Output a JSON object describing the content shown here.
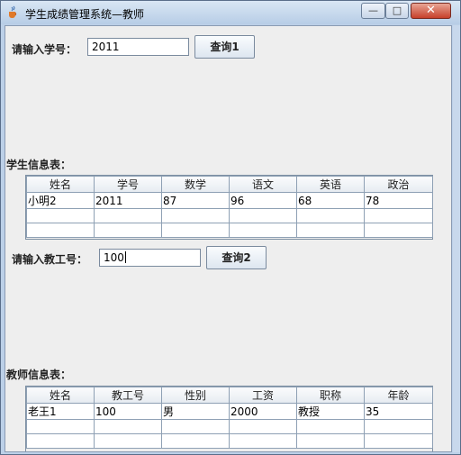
{
  "window": {
    "title": "学生成绩管理系统—教师"
  },
  "student_query": {
    "label": "请输入学号：",
    "value": "2011",
    "button": "查询1"
  },
  "student_table": {
    "caption": "学生信息表：",
    "headers": [
      "姓名",
      "学号",
      "数学",
      "语文",
      "英语",
      "政治"
    ],
    "rows": [
      [
        "小明2",
        "2011",
        "87",
        "96",
        "68",
        "78"
      ],
      [
        "",
        "",
        "",
        "",
        "",
        ""
      ],
      [
        "",
        "",
        "",
        "",
        "",
        ""
      ]
    ]
  },
  "teacher_query": {
    "label": "请输入教工号：",
    "value": "100",
    "button": "查询2"
  },
  "teacher_table": {
    "caption": "教师信息表：",
    "headers": [
      "姓名",
      "教工号",
      "性别",
      "工资",
      "职称",
      "年龄"
    ],
    "rows": [
      [
        "老王1",
        "100",
        "男",
        "2000",
        "教授",
        "35"
      ],
      [
        "",
        "",
        "",
        "",
        "",
        ""
      ],
      [
        "",
        "",
        "",
        "",
        "",
        ""
      ]
    ]
  },
  "icons": {
    "app": "java-cup-icon",
    "minimize": "minimize-icon",
    "maximize": "maximize-icon",
    "close": "close-icon"
  }
}
